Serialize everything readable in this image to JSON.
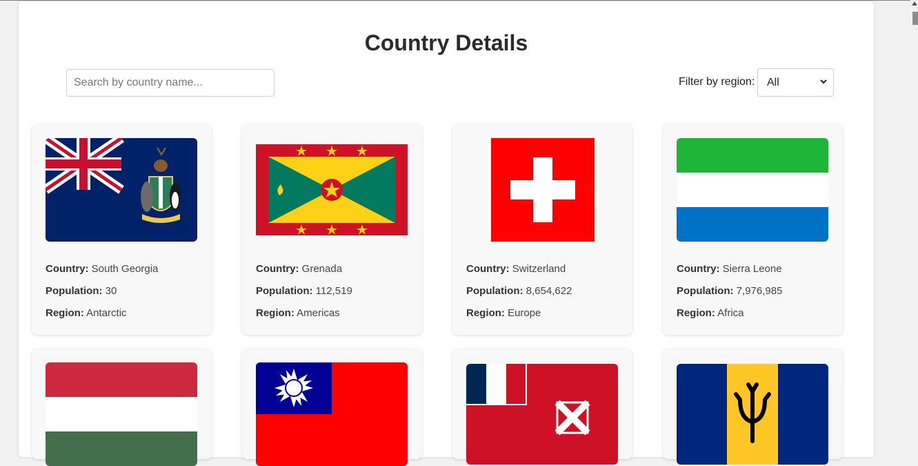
{
  "page": {
    "title": "Country Details"
  },
  "search": {
    "placeholder": "Search by country name..."
  },
  "filter": {
    "label": "Filter by region:",
    "selected": "All",
    "options": [
      "All"
    ]
  },
  "labels": {
    "country": "Country:",
    "population": "Population:",
    "region": "Region:"
  },
  "countries": [
    {
      "name": "South Georgia",
      "population": "30",
      "region": "Antarctic",
      "flag": "south-georgia-flag"
    },
    {
      "name": "Grenada",
      "population": "112,519",
      "region": "Americas",
      "flag": "grenada-flag"
    },
    {
      "name": "Switzerland",
      "population": "8,654,622",
      "region": "Europe",
      "flag": "switzerland-flag"
    },
    {
      "name": "Sierra Leone",
      "population": "7,976,985",
      "region": "Africa",
      "flag": "sierra-leone-flag"
    }
  ],
  "partial_row_flags": [
    "hungary-flag",
    "taiwan-flag",
    "wallis-futuna-flag",
    "barbados-flag"
  ],
  "colors": {
    "text": "#2b2b2b",
    "card": "#f8f8f8",
    "background": "#f1f1f1"
  }
}
